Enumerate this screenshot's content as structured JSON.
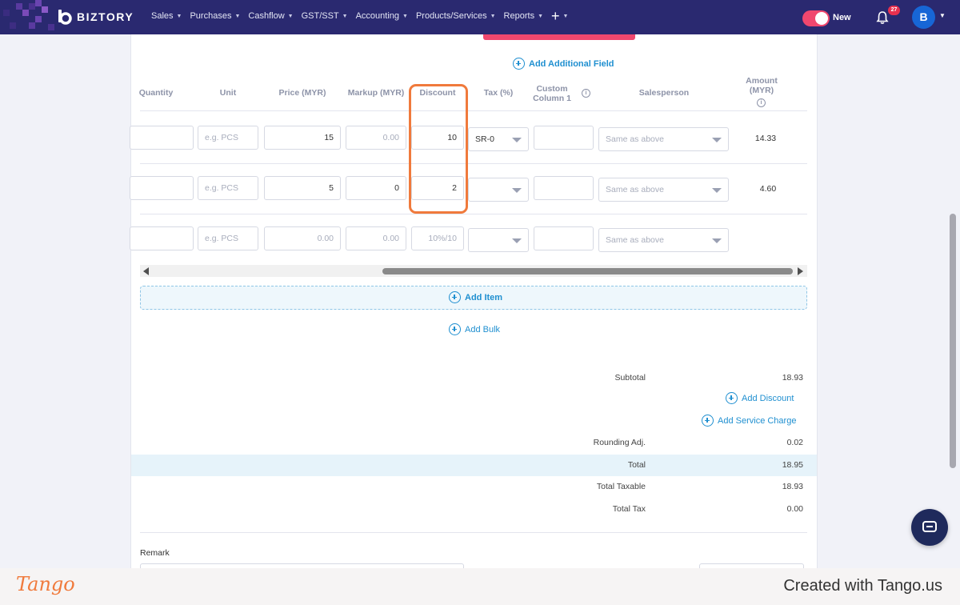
{
  "navbar": {
    "brand": "BIZTORY",
    "menu": [
      {
        "label": "Sales"
      },
      {
        "label": "Purchases"
      },
      {
        "label": "Cashflow"
      },
      {
        "label": "GST/SST"
      },
      {
        "label": "Accounting"
      },
      {
        "label": "Products/Services"
      },
      {
        "label": "Reports"
      }
    ],
    "plus": "+",
    "toggle_label": "New",
    "toggle_color": "#f0476e",
    "notification_count": "27",
    "avatar_initial": "B",
    "accent": "#2a2970"
  },
  "form": {
    "add_additional_field": "Add Additional Field",
    "columns": {
      "quantity": "Quantity",
      "unit": "Unit",
      "price": "Price (MYR)",
      "markup": "Markup (MYR)",
      "discount": "Discount",
      "tax": "Tax (%)",
      "custom_column_line1": "Custom",
      "custom_column_line2": "Column 1",
      "salesperson": "Salesperson",
      "amount_line1": "Amount",
      "amount_line2": "(MYR)"
    },
    "rows": [
      {
        "unit_placeholder": "e.g. PCS",
        "price": "15",
        "markup": "0.00",
        "discount": "10",
        "tax": "SR-0",
        "salesperson": "Same as above",
        "amount": "14.33"
      },
      {
        "unit_placeholder": "e.g. PCS",
        "price": "5",
        "markup": "0",
        "discount": "2",
        "tax": "",
        "salesperson": "Same as above",
        "amount": "4.60"
      },
      {
        "unit_placeholder": "e.g. PCS",
        "price": "0.00",
        "markup": "0.00",
        "discount": "10%/10",
        "tax": "",
        "salesperson": "Same as above",
        "amount": ""
      }
    ],
    "add_item": "Add Item",
    "add_bulk": "Add Bulk"
  },
  "summary": {
    "subtotal_label": "Subtotal",
    "subtotal": "18.93",
    "add_discount": "Add Discount",
    "add_service_charge": "Add Service Charge",
    "rounding_label": "Rounding Adj.",
    "rounding": "0.02",
    "total_label": "Total",
    "total": "18.95",
    "total_taxable_label": "Total Taxable",
    "total_taxable": "18.93",
    "total_tax_label": "Total Tax",
    "total_tax": "0.00"
  },
  "remark_label": "Remark",
  "footer": {
    "logo": "Tango",
    "credit": "Created with Tango.us"
  }
}
